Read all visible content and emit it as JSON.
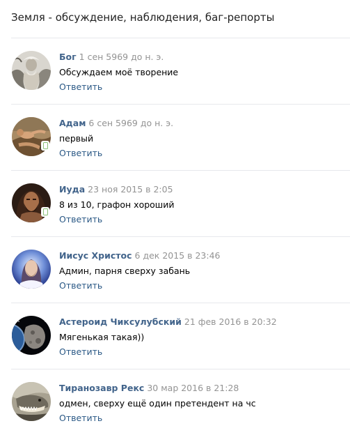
{
  "topic": {
    "title": "Земля - обсуждение, наблюдения, баг-репорты"
  },
  "comments": [
    {
      "author": "Бог",
      "date": "1 сен 5969 до н. э.",
      "text": "Обсуждаем моё творение",
      "reply": "Ответить",
      "avatar_icon": "god-portrait",
      "mobile": false
    },
    {
      "author": "Адам",
      "date": "6 сен 5969 до н. э.",
      "text": "первый",
      "reply": "Ответить",
      "avatar_icon": "adam-painting",
      "mobile": true
    },
    {
      "author": "Иуда",
      "date": "23 ноя 2015 в 2:05",
      "text": "8 из 10, графон хороший",
      "reply": "Ответить",
      "avatar_icon": "judas-portrait",
      "mobile": true
    },
    {
      "author": "Иисус Христос",
      "date": "6 дек 2015 в 23:46",
      "text": "Админ, парня сверху забань",
      "reply": "Ответить",
      "avatar_icon": "jesus-portrait",
      "mobile": false
    },
    {
      "author": "Астероид Чиксулубский",
      "date": "21 фев 2016 в 20:32",
      "text": "Мягенькая такая))",
      "reply": "Ответить",
      "avatar_icon": "asteroid-photo",
      "mobile": false
    },
    {
      "author": "Тиранозавр Рекс",
      "date": "30 мар 2016 в 21:28",
      "text": "одмен, сверху ещё один претендент на чс",
      "reply": "Ответить",
      "avatar_icon": "trex-photo",
      "mobile": false
    }
  ],
  "colors": {
    "author_link": "#42648b",
    "reply_link": "#2a5885",
    "date_gray": "#939393",
    "divider": "#e7e8ec",
    "mobile_indicator": "#8ac176"
  }
}
